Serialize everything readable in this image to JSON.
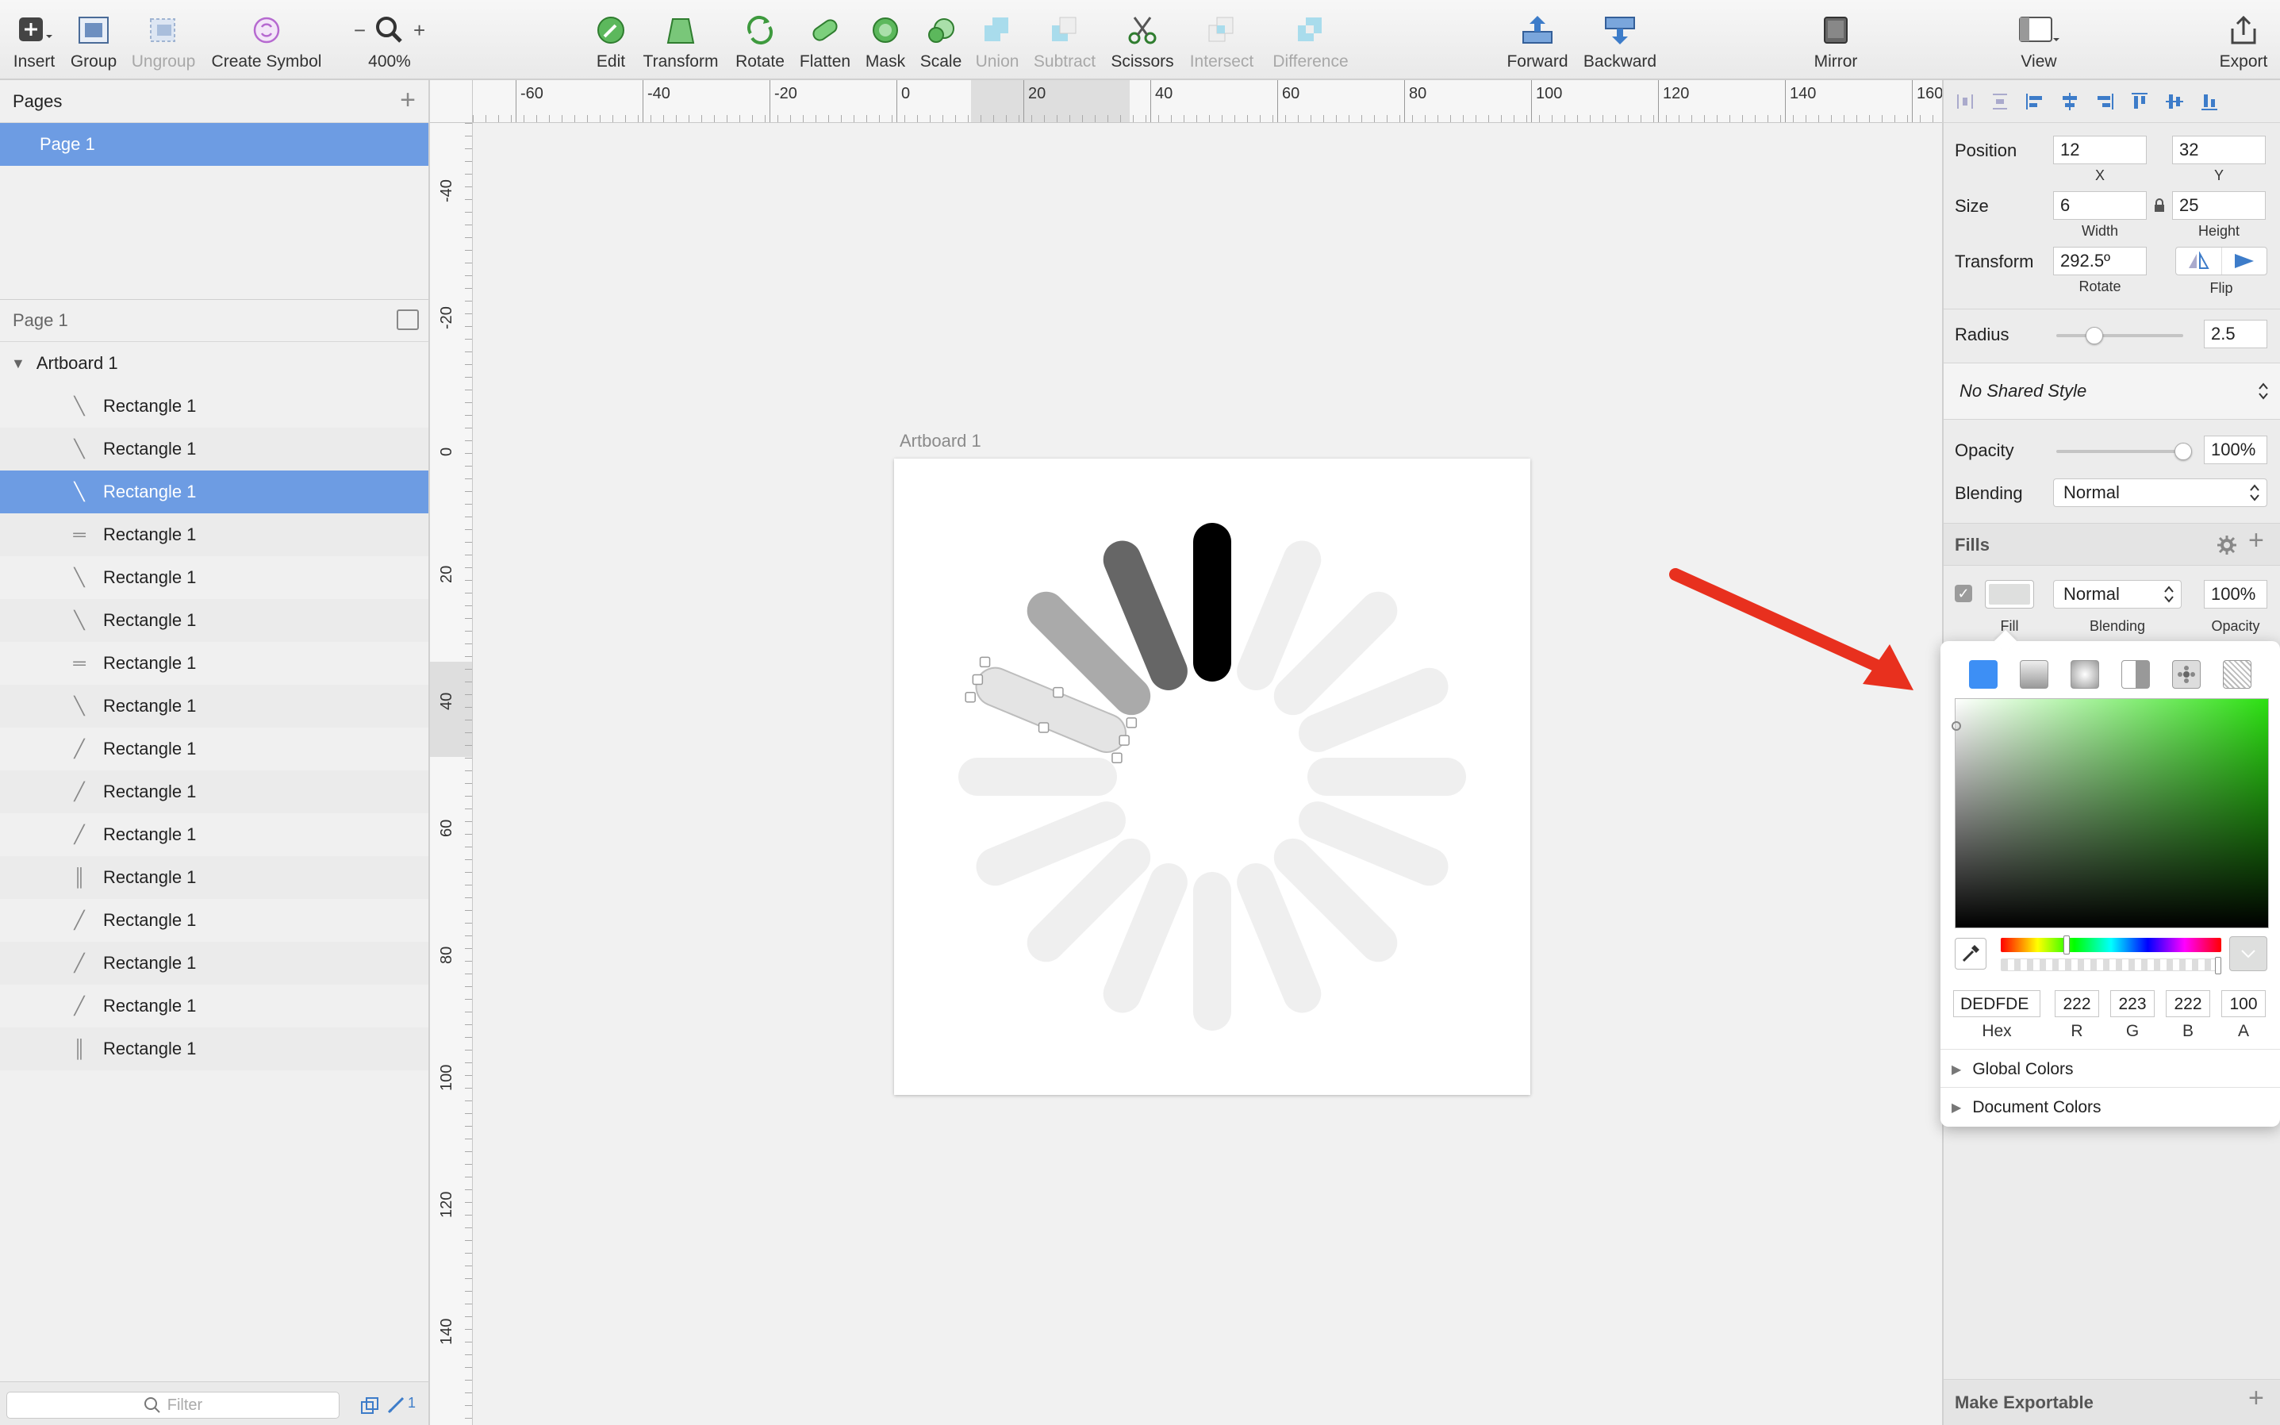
{
  "toolbar": {
    "insert": "Insert",
    "group": "Group",
    "ungroup": "Ungroup",
    "create_symbol": "Create Symbol",
    "zoom_minus": "−",
    "zoom_plus": "+",
    "zoom": "400%",
    "edit": "Edit",
    "transform": "Transform",
    "rotate": "Rotate",
    "flatten": "Flatten",
    "mask": "Mask",
    "scale": "Scale",
    "union": "Union",
    "subtract": "Subtract",
    "scissors": "Scissors",
    "intersect": "Intersect",
    "difference": "Difference",
    "forward": "Forward",
    "backward": "Backward",
    "mirror": "Mirror",
    "view": "View",
    "export": "Export"
  },
  "pages": {
    "title": "Pages",
    "add": "+",
    "items": [
      {
        "label": "Page 1"
      }
    ],
    "current": "Page 1"
  },
  "layers": {
    "artboard": "Artboard 1",
    "items": [
      {
        "label": "Rectangle 1",
        "glyph": "╲"
      },
      {
        "label": "Rectangle 1",
        "glyph": "╲"
      },
      {
        "label": "Rectangle 1",
        "glyph": "╲"
      },
      {
        "label": "Rectangle 1",
        "glyph": "═"
      },
      {
        "label": "Rectangle 1",
        "glyph": "╲"
      },
      {
        "label": "Rectangle 1",
        "glyph": "╲"
      },
      {
        "label": "Rectangle 1",
        "glyph": "═"
      },
      {
        "label": "Rectangle 1",
        "glyph": "╲"
      },
      {
        "label": "Rectangle 1",
        "glyph": "╱"
      },
      {
        "label": "Rectangle 1",
        "glyph": "╱"
      },
      {
        "label": "Rectangle 1",
        "glyph": "╱"
      },
      {
        "label": "Rectangle 1",
        "glyph": "║"
      },
      {
        "label": "Rectangle 1",
        "glyph": "╱"
      },
      {
        "label": "Rectangle 1",
        "glyph": "╱"
      },
      {
        "label": "Rectangle 1",
        "glyph": "╱"
      },
      {
        "label": "Rectangle 1",
        "glyph": "║"
      }
    ],
    "filter_placeholder": "Filter",
    "footer_count": "1"
  },
  "rulers": {
    "h_labels": [
      "-60",
      "-40",
      "-20",
      "0",
      "20",
      "40",
      "60",
      "80",
      "100",
      "120",
      "140",
      "160"
    ],
    "v_labels": [
      "-40",
      "-20",
      "0",
      "20",
      "40",
      "60",
      "80",
      "100",
      "120",
      "140"
    ]
  },
  "canvas": {
    "artboard_label": "Artboard 1"
  },
  "inspector": {
    "position_label": "Position",
    "x": "12",
    "y": "32",
    "x_label": "X",
    "y_label": "Y",
    "size_label": "Size",
    "width": "6",
    "height": "25",
    "width_label": "Width",
    "height_label": "Height",
    "transform_label": "Transform",
    "rotate": "292.5º",
    "rotate_label": "Rotate",
    "flip_label": "Flip",
    "radius_label": "Radius",
    "radius": "2.5",
    "radius_level": 0.3,
    "shared_style": "No Shared Style",
    "opacity_label": "Opacity",
    "opacity": "100%",
    "opacity_level": 1.0,
    "blending_label": "Blending",
    "blending": "Normal",
    "fills_label": "Fills",
    "fill_blending": "Normal",
    "fill_opacity": "100%",
    "fill_sub": "Fill",
    "fill_blending_sub": "Blending",
    "fill_opacity_sub": "Opacity",
    "make_exportable": "Make Exportable"
  },
  "color_picker": {
    "hex": "DEDFDE",
    "r": "222",
    "g": "223",
    "b": "222",
    "a": "100",
    "hex_label": "Hex",
    "r_label": "R",
    "g_label": "G",
    "b_label": "B",
    "a_label": "A",
    "global_colors": "Global Colors",
    "document_colors": "Document Colors",
    "hue_level": 0.3
  },
  "colors": {
    "accent": "#3d8ff5",
    "selection": "#6d9ce3",
    "arrow": "#e8301e",
    "spoke_light": "#efefef"
  }
}
